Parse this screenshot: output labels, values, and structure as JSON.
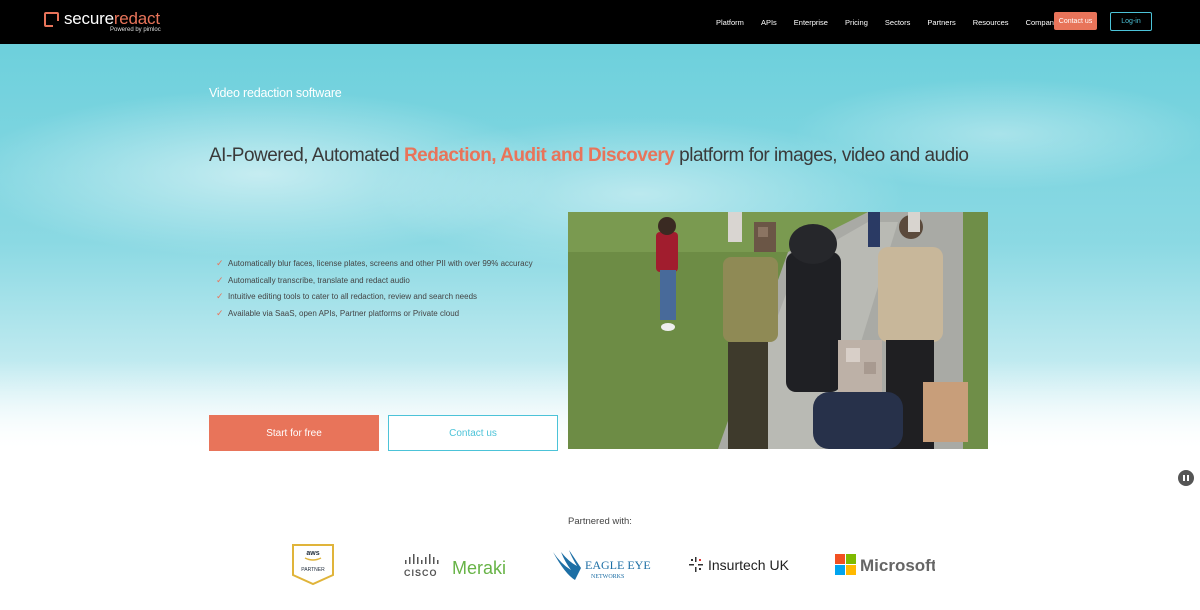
{
  "brand": {
    "name_part1": "secure",
    "name_part2": "redact",
    "powered_by": "Powered by pimloc"
  },
  "nav": {
    "links": [
      "Platform",
      "APIs",
      "Enterprise",
      "Pricing",
      "Sectors",
      "Partners",
      "Resources",
      "Company"
    ],
    "contact_label": "Contact us",
    "login_label": "Log-in"
  },
  "hero": {
    "eyebrow": "Video redaction software",
    "headline_pre": "AI-Powered, Automated ",
    "headline_highlight": "Redaction, Audit and Discovery",
    "headline_post": " platform for images, video and audio",
    "features": [
      "Automatically blur faces, license plates, screens and other PII with over 99% accuracy",
      "Automatically transcribe, translate and redact audio",
      "Intuitive editing tools to cater to all redaction, review and search needs",
      "Available via SaaS, open APIs, Partner platforms or Private cloud"
    ],
    "check_glyph": "✓",
    "start_label": "Start for free",
    "contact_label": "Contact us"
  },
  "partners": {
    "heading": "Partnered with:",
    "aws_top": "aws",
    "aws_bottom": "PARTNER",
    "cisco_word": "CISCO",
    "meraki_word": "Meraki",
    "eagle_line1": "EAGLE EYE",
    "eagle_line2": "NETWORKS",
    "insurtech": "Insurtech UK",
    "microsoft": "Microsoft"
  },
  "colors": {
    "accent": "#e8745a",
    "teal": "#4cc3d8",
    "nav_bg": "#000000"
  }
}
